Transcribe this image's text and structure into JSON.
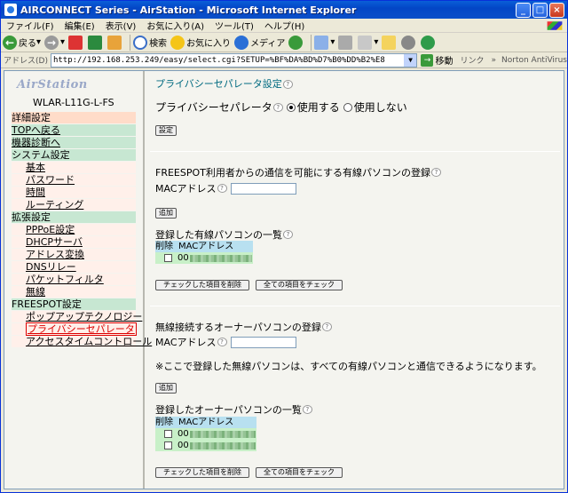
{
  "window": {
    "title": "AIRCONNECT Series - AirStation - Microsoft Internet Explorer"
  },
  "menu": [
    "ファイル(F)",
    "編集(E)",
    "表示(V)",
    "お気に入り(A)",
    "ツール(T)",
    "ヘルプ(H)"
  ],
  "toolbar": {
    "back": "戻る",
    "search": "検索",
    "favorites": "お気に入り",
    "media": "メディア"
  },
  "address": {
    "label": "アドレス(D)",
    "url": "http://192.168.253.249/easy/select.cgi?SETUP=%BF%DA%BD%D7%B0%DD%B2%E8",
    "go": "移動",
    "links": "リンク",
    "norton": "Norton AntiVirus"
  },
  "sidebar": {
    "logo": "AirStation",
    "model": "WLAR-L11G-L-FS",
    "items": [
      {
        "label": "詳細設定",
        "kind": "hl"
      },
      {
        "label": "TOPへ戻る",
        "kind": "head-link"
      },
      {
        "label": "機器診断へ",
        "kind": "head-link"
      },
      {
        "label": "システム設定",
        "kind": "head"
      },
      {
        "label": "基本",
        "kind": "sub"
      },
      {
        "label": "パスワード",
        "kind": "sub"
      },
      {
        "label": "時間",
        "kind": "sub"
      },
      {
        "label": "ルーティング",
        "kind": "sub"
      },
      {
        "label": "拡張設定",
        "kind": "head"
      },
      {
        "label": "PPPoE設定",
        "kind": "sub"
      },
      {
        "label": "DHCPサーバ",
        "kind": "sub"
      },
      {
        "label": "アドレス変換",
        "kind": "sub"
      },
      {
        "label": "DNSリレー",
        "kind": "sub"
      },
      {
        "label": "パケットフィルタ",
        "kind": "sub"
      },
      {
        "label": "無線",
        "kind": "sub"
      },
      {
        "label": "FREESPOT設定",
        "kind": "head"
      },
      {
        "label": "ポップアップテクノロジー",
        "kind": "sub"
      },
      {
        "label": "プライバシーセパレータ",
        "kind": "sub-cur"
      },
      {
        "label": "アクセスタイムコントロール",
        "kind": "sub"
      }
    ]
  },
  "main": {
    "title": "プライバシーセパレータ設定",
    "privacy_label": "プライバシーセパレータ",
    "opt_on": "使用する",
    "opt_off": "使用しない",
    "set_button": "設定",
    "wired_title": "FREESPOT利用者からの通信を可能にする有線パソコンの登録",
    "mac_label": "MACアドレス",
    "add_button": "追加",
    "wired_list_title": "登録した有線パソコンの一覧",
    "col_delete": "削除",
    "col_mac": "MACアドレス",
    "wired_rows": [
      "00"
    ],
    "delete_checked": "チェックした項目を削除",
    "check_all": "全ての項目をチェック",
    "owner_title": "無線接続するオーナーパソコンの登録",
    "owner_note": "※ここで登録した無線パソコンは、すべての有線パソコンと通信できるようになります。",
    "owner_list_title": "登録したオーナーパソコンの一覧",
    "owner_rows": [
      "00",
      "00"
    ]
  }
}
